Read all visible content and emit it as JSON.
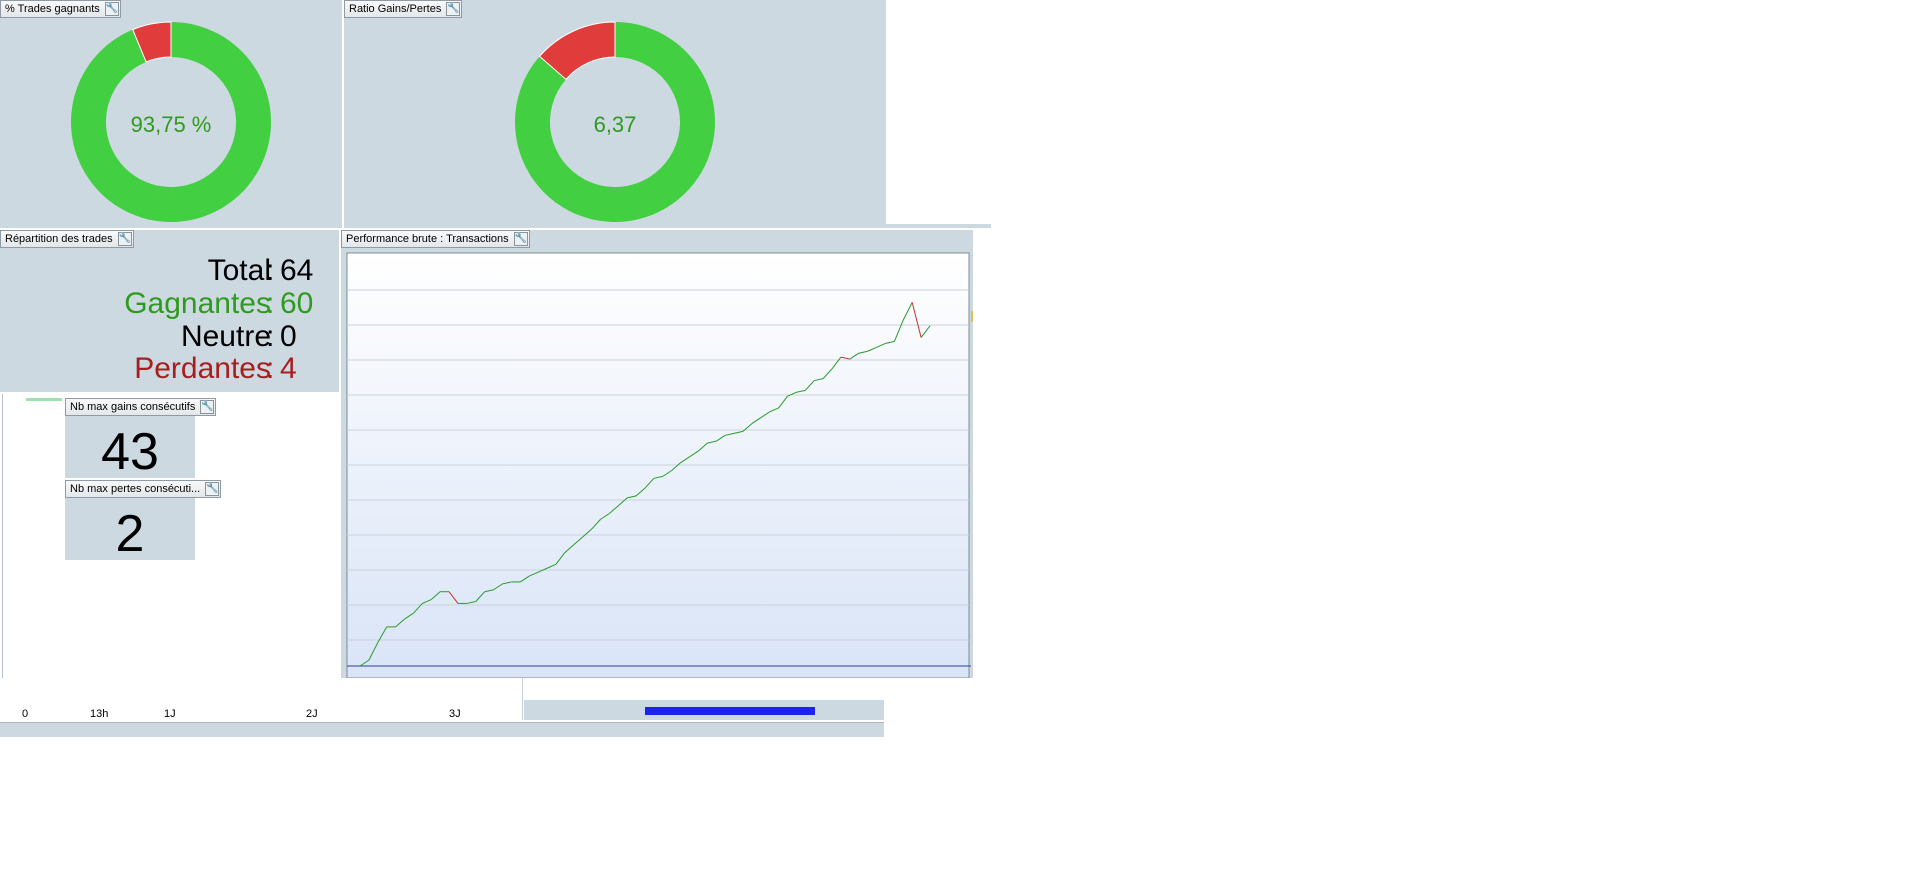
{
  "win_trades": {
    "title": "% Trades gagnants",
    "label": "93,75 %",
    "win_fraction": 0.9375,
    "color_win": "#42cf42",
    "color_loss": "#e03c3c"
  },
  "gain_ratio": {
    "title": "Ratio Gains/Pertes",
    "label": "6,37",
    "win_fraction": 0.864
  },
  "distribution": {
    "title": "Répartition des trades",
    "total_label": "Total",
    "total_value": "64",
    "win_label": "Gagnantes",
    "win_value": "60",
    "neutral_label": "Neutre",
    "neutral_value": "0",
    "loss_label": "Perdantes",
    "loss_value": "4",
    "separator": ":"
  },
  "max_gains": {
    "title": "Nb max gains consécutifs",
    "value": "43"
  },
  "max_losses": {
    "title": "Nb max pertes consécuti...",
    "value": "2"
  },
  "performance": {
    "title": "Performance brute : Transactions"
  },
  "timeline": {
    "labels": [
      "0",
      "13h",
      "1J",
      "2J",
      "3J"
    ]
  },
  "wrench_glyph": "🔧",
  "chart_data": {
    "type": "line",
    "title": "Performance brute : Transactions",
    "xlabel": "",
    "ylabel": "",
    "grid": true,
    "colors": {
      "gain": "#2a9a2a",
      "loss": "#d02a2a"
    },
    "ylim": [
      0,
      100
    ],
    "x": [
      0,
      1,
      2,
      3,
      4,
      5,
      6,
      7,
      8,
      9,
      10,
      11,
      12,
      13,
      14,
      15,
      16,
      17,
      18,
      19,
      20,
      21,
      22,
      23,
      24,
      25,
      26,
      27,
      28,
      29,
      30,
      31,
      32,
      33,
      34,
      35,
      36,
      37,
      38,
      39,
      40,
      41,
      42,
      43,
      44,
      45,
      46,
      47,
      48,
      49,
      50,
      51,
      52,
      53,
      54,
      55,
      56,
      57,
      58,
      59,
      60,
      61,
      62,
      63,
      64
    ],
    "values": [
      0,
      1.5,
      6,
      10,
      10,
      12,
      13.5,
      16,
      17,
      19,
      19,
      16,
      16,
      16.5,
      19,
      19.5,
      21,
      21.5,
      21.5,
      23,
      24,
      25,
      26,
      29,
      31,
      33,
      35,
      37.5,
      39,
      41,
      43,
      43.5,
      45.5,
      48,
      48.5,
      50,
      52,
      53.5,
      55,
      57,
      57.5,
      59,
      59.5,
      60,
      62,
      63.5,
      65,
      66,
      69,
      70,
      70.5,
      73,
      73.5,
      76,
      79,
      78.5,
      80,
      80.5,
      81.5,
      82.5,
      83,
      88.5,
      93,
      84,
      87
    ]
  }
}
